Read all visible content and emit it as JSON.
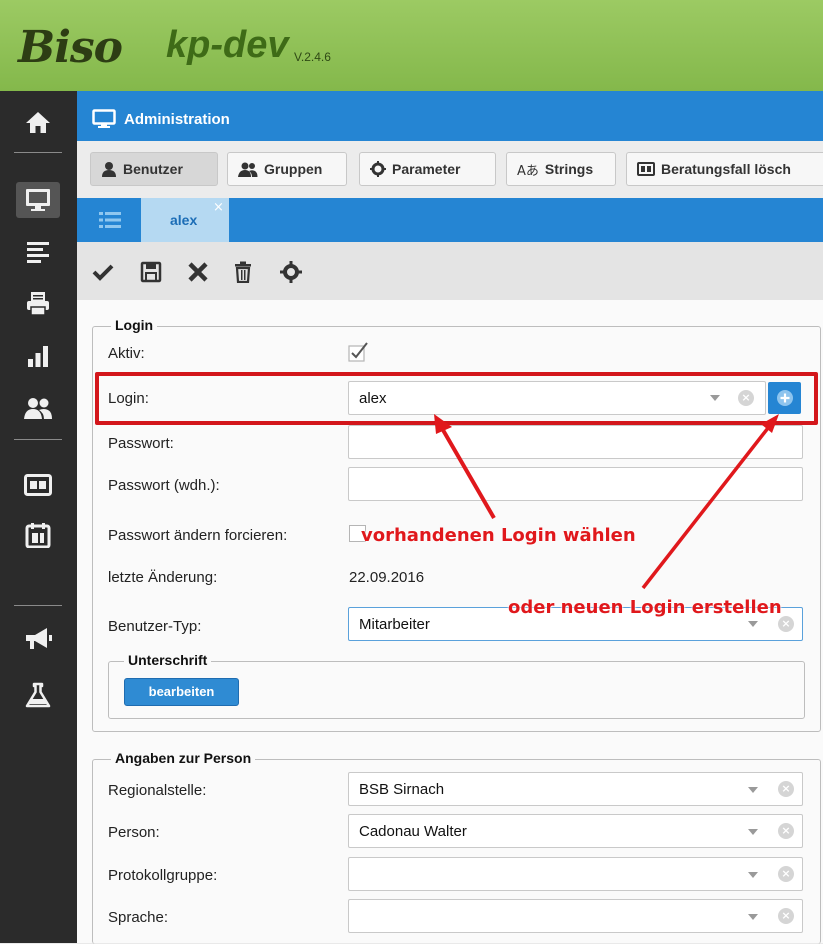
{
  "header": {
    "logo_biso": "Biso",
    "logo_kp": "kp-dev",
    "version": "V.2.4.6"
  },
  "left_nav": [
    "home-icon",
    "monitor-icon",
    "list-icon",
    "printer-icon",
    "bar-chart-icon",
    "users-icon",
    "id-card-icon",
    "calendar-icon",
    "megaphone-icon",
    "flask-icon"
  ],
  "admin": {
    "title": "Administration"
  },
  "tabs": [
    {
      "label": "Benutzer"
    },
    {
      "label": "Gruppen"
    },
    {
      "label": "Parameter"
    },
    {
      "label": "Strings",
      "icon_text": "Aあ"
    },
    {
      "label": "Beratungsfall lösch"
    }
  ],
  "doc_tab": {
    "label": "alex",
    "close": "×"
  },
  "login_section": {
    "legend": "Login",
    "aktiv_label": "Aktiv:",
    "aktiv_checked": true,
    "login_label": "Login:",
    "login_value": "alex",
    "passwort_label": "Passwort:",
    "passwort_wdh_label": "Passwort (wdh.):",
    "forcieren_label": "Passwort ändern forcieren:",
    "letzte_label": "letzte Änderung:",
    "letzte_value": "22.09.2016",
    "typ_label": "Benutzer-Typ:",
    "typ_value": "Mitarbeiter",
    "unterschrift_legend": "Unterschrift",
    "bearbeiten_button": "bearbeiten"
  },
  "person_section": {
    "legend": "Angaben zur Person",
    "regional_label": "Regionalstelle:",
    "regional_value": "BSB Sirnach",
    "person_label": "Person:",
    "person_value": "Cadonau Walter",
    "protokoll_label": "Protokollgruppe:",
    "protokoll_value": "",
    "sprache_label": "Sprache:",
    "sprache_value": ""
  },
  "annotations": {
    "choose_existing": "vorhandenen Login wählen",
    "create_new": "oder neuen Login erstellen"
  },
  "colors": {
    "header_green": "#8bc056",
    "primary_blue": "#2585d3",
    "sidebar_dark": "#2b2b2b",
    "annotation_red": "#d3161b"
  }
}
